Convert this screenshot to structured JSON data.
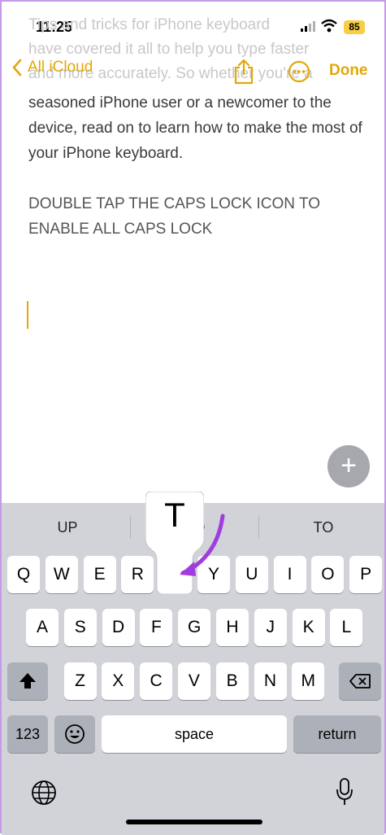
{
  "status_bar": {
    "time": "11:25",
    "battery": "85"
  },
  "nav": {
    "back_label": "All iCloud",
    "done_label": "Done"
  },
  "note": {
    "faded_lines": [
      "Tips and tricks for iPhone keyboard",
      "have covered it all to help you type faster",
      "and more accurately. So whether you're a"
    ],
    "paragraph": "seasoned iPhone user or a newcomer to the device, read on to learn how to make the most of your iPhone keyboard.",
    "caps_text": "DOUBLE TAP THE CAPS LOCK ICON TO ENABLE ALL CAPS LOCK"
  },
  "keyboard": {
    "suggestions": [
      "UP",
      "TO",
      "TO"
    ],
    "popup_letter": "T",
    "row1": [
      "Q",
      "W",
      "E",
      "R",
      "T",
      "Y",
      "U",
      "I",
      "O",
      "P"
    ],
    "row2": [
      "A",
      "S",
      "D",
      "F",
      "G",
      "H",
      "J",
      "K",
      "L"
    ],
    "row3": [
      "Z",
      "X",
      "C",
      "V",
      "B",
      "N",
      "M"
    ],
    "numbers_label": "123",
    "space_label": "space",
    "return_label": "return"
  },
  "colors": {
    "accent": "#e3a706",
    "annotation_arrow": "#a13de0"
  }
}
